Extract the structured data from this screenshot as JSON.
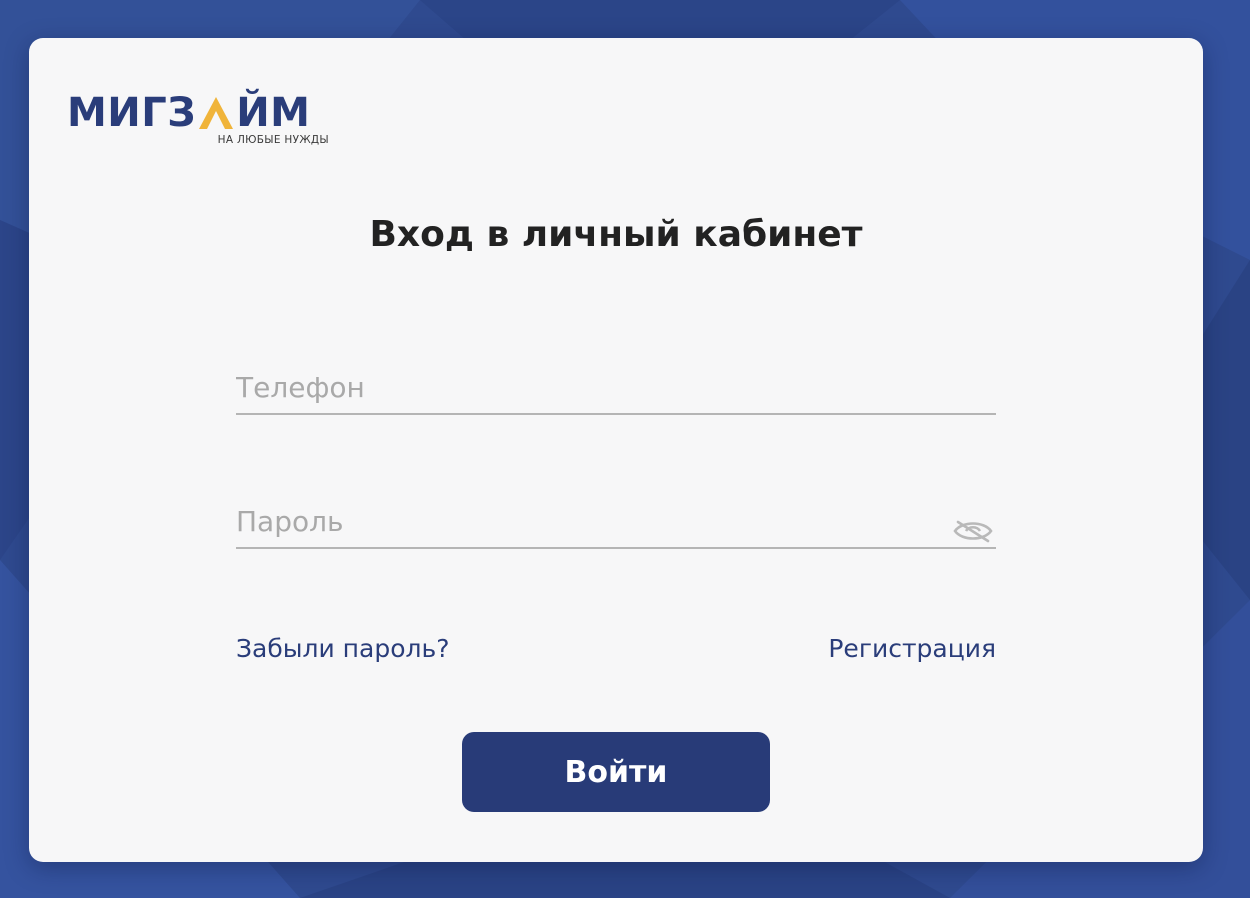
{
  "colors": {
    "background": "#2f4a8f",
    "card": "#f7f7f8",
    "brand": "#2a3d7a",
    "brand_accent": "#f0b43a",
    "button": "#283b78",
    "underline": "#b5b5b5",
    "placeholder": "#a9a9a9"
  },
  "logo": {
    "word_start": "МИГЗ",
    "word_end": "ЙМ",
    "accent_glyph": "Λ",
    "tagline": "НА ЛЮБЫЕ НУЖДЫ"
  },
  "title": "Вход в личный кабинет",
  "form": {
    "phone": {
      "placeholder": "Телефон",
      "value": ""
    },
    "password": {
      "placeholder": "Пароль",
      "value": "",
      "toggle_icon": "eye-hidden-icon"
    },
    "forgot_link": "Забыли пароль?",
    "register_link": "Регистрация",
    "submit_label": "Войти"
  }
}
